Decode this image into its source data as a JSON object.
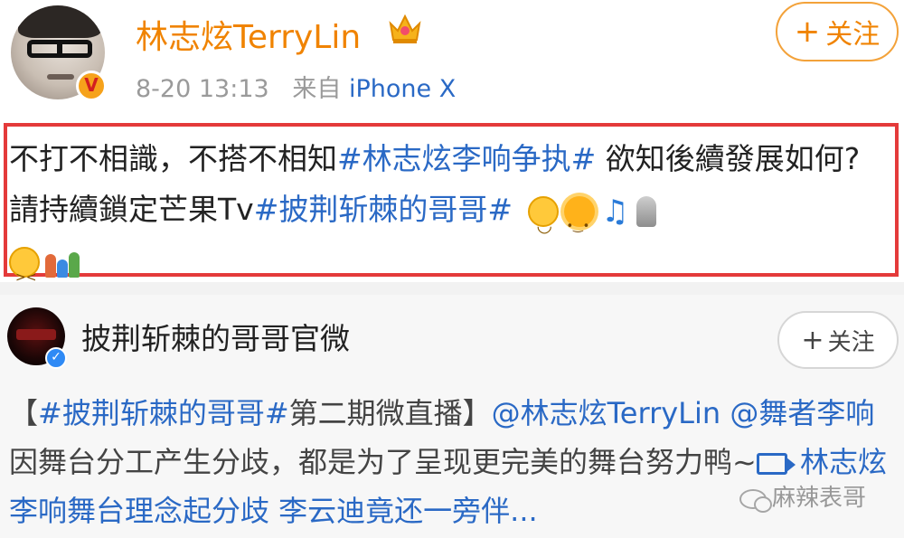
{
  "post": {
    "author": "林志炫TerryLin",
    "time": "8-20 13:13",
    "source_prefix": "来自",
    "source": "iPhone X",
    "follow_label": "关注",
    "text": {
      "p1": "不打不相識，不搭不相知",
      "tag1": "#林志炫李响争执#",
      "p2": " 欲知後續發展如何? 請持續鎖定芒果Tv",
      "tag2": "#披荆斩棘的哥哥#"
    },
    "emojis": [
      "smile-emoji",
      "sun-emoji",
      "music-note-emoji",
      "microphone-emoji",
      "flushed-emoji",
      "family-emoji"
    ]
  },
  "repost": {
    "author": "披荆斩棘的哥哥官微",
    "follow_label": "关注",
    "text": {
      "bracket_open": "【",
      "tag": "#披荆斩棘的哥哥#",
      "title_rest": "第二期微直播】",
      "mention1": "@林志炫TerryLin",
      "mention2": "@舞者李响",
      "body": " 因舞台分工产生分歧，都是为了呈现更完美的舞台努力鸭~",
      "video_link": "林志炫李响舞台理念起分歧 李云迪竟还一旁伴..."
    }
  },
  "watermark": "麻辣表哥",
  "colors": {
    "author_orange": "#f08300",
    "link_blue": "#2a69c5",
    "highlight_red": "#e43a3a"
  }
}
